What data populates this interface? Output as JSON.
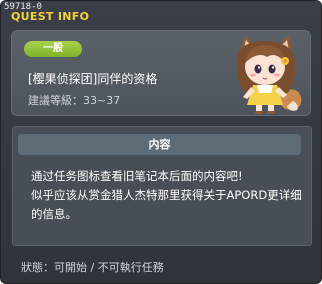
{
  "window": {
    "quest_id": "59718-0",
    "title": "QUEST INFO"
  },
  "quest": {
    "category": "一般",
    "name": "[樱果侦探团]同伴的资格",
    "level": "建議等級：33~37"
  },
  "content": {
    "header": "内容",
    "lines": [
      "通过任务图标查看旧笔记本后面的内容吧!",
      "似乎应该从赏金猎人杰特那里获得关于APORD更详细",
      "的信息。"
    ]
  },
  "status": "狀態：可開始 / 不可執行任務",
  "npc": {
    "name": "fox-girl-npc"
  },
  "colors": {
    "title": "#f6d23a",
    "badge": "#8fc23a",
    "background": "#353a41",
    "content_header": "#5e6c77"
  }
}
